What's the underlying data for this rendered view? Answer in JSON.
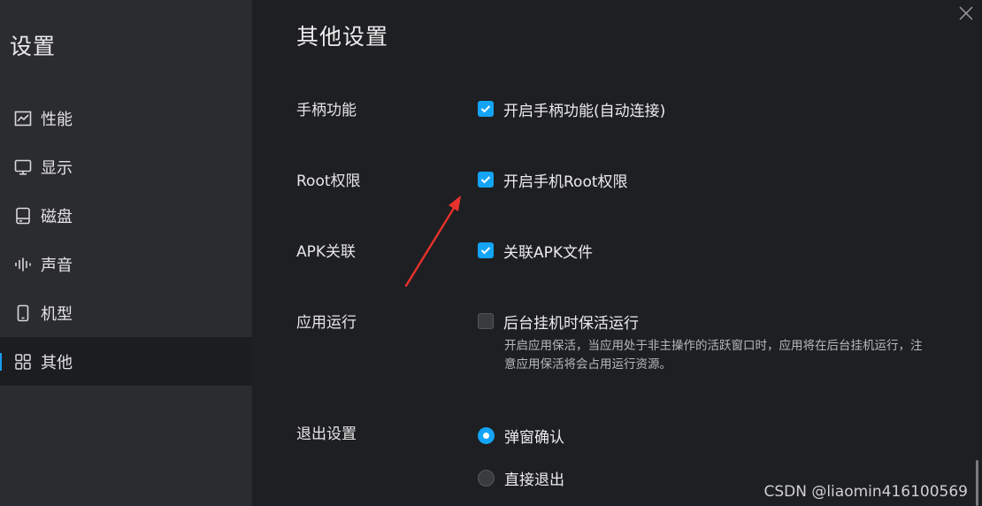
{
  "sidebar": {
    "title": "设置",
    "items": [
      {
        "label": "性能",
        "icon": "performance-chart-icon"
      },
      {
        "label": "显示",
        "icon": "monitor-icon"
      },
      {
        "label": "磁盘",
        "icon": "disk-icon"
      },
      {
        "label": "声音",
        "icon": "sound-wave-icon"
      },
      {
        "label": "机型",
        "icon": "phone-icon"
      },
      {
        "label": "其他",
        "icon": "grid-icon",
        "active": true
      }
    ]
  },
  "section": {
    "title": "其他设置"
  },
  "settings": {
    "gamepad": {
      "label": "手柄功能",
      "option": "开启手柄功能(自动连接)",
      "checked": true
    },
    "root": {
      "label": "Root权限",
      "option": "开启手机Root权限",
      "checked": true
    },
    "apk": {
      "label": "APK关联",
      "option": "关联APK文件",
      "checked": true
    },
    "app_run": {
      "label": "应用运行",
      "option": "后台挂机时保活运行",
      "checked": false,
      "description": "开启应用保活，当应用处于非主操作的活跃窗口时，应用将在后台挂机运行，注意应用保活将会占用运行资源。"
    },
    "exit": {
      "label": "退出设置",
      "options": [
        {
          "label": "弹窗确认",
          "selected": true
        },
        {
          "label": "直接退出",
          "selected": false
        }
      ]
    }
  },
  "watermark": "CSDN @liaomin416100569",
  "colors": {
    "accent": "#14a4f5",
    "sidebar_bg": "#2b2c30",
    "main_bg": "#1e1f22",
    "annotation_arrow": "#e8322b"
  }
}
